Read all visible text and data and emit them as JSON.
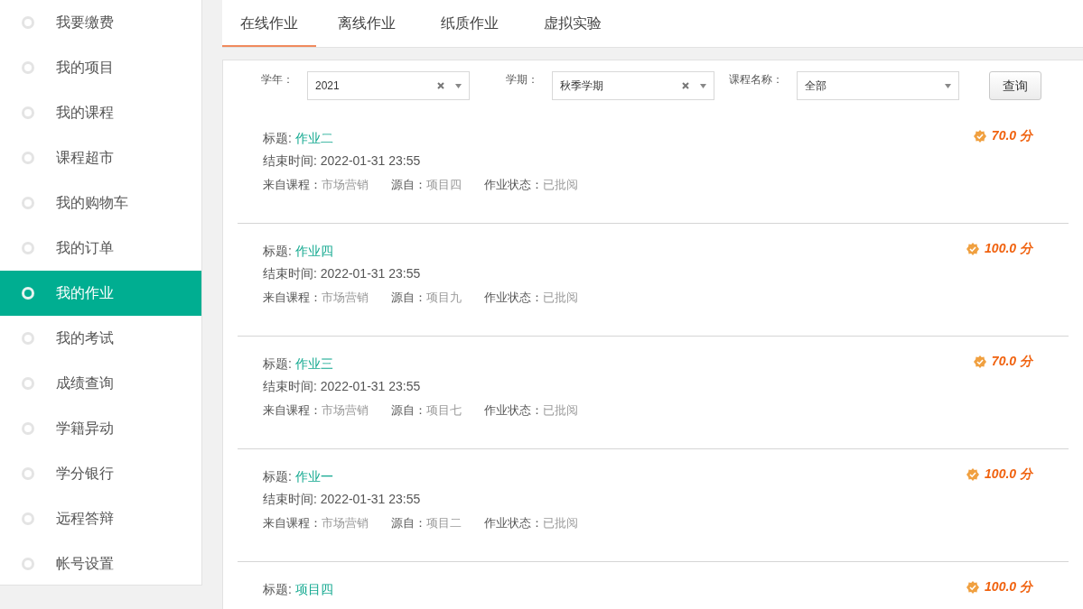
{
  "sidebar": {
    "items": [
      {
        "label": "我要缴费",
        "selected": false
      },
      {
        "label": "我的项目",
        "selected": false
      },
      {
        "label": "我的课程",
        "selected": false
      },
      {
        "label": "课程超市",
        "selected": false
      },
      {
        "label": "我的购物车",
        "selected": false
      },
      {
        "label": "我的订单",
        "selected": false
      },
      {
        "label": "我的作业",
        "selected": true
      },
      {
        "label": "我的考试",
        "selected": false
      },
      {
        "label": "成绩查询",
        "selected": false
      },
      {
        "label": "学籍异动",
        "selected": false
      },
      {
        "label": "学分银行",
        "selected": false
      },
      {
        "label": "远程答辩",
        "selected": false
      },
      {
        "label": "帐号设置",
        "selected": false
      }
    ]
  },
  "tabs": [
    {
      "label": "在线作业",
      "selected": true
    },
    {
      "label": "离线作业",
      "selected": false
    },
    {
      "label": "纸质作业",
      "selected": false
    },
    {
      "label": "虚拟实验",
      "selected": false
    }
  ],
  "filters": [
    {
      "label": "学年：",
      "value": "2021",
      "clearable": true
    },
    {
      "label": "学期：",
      "value": "秋季学期",
      "clearable": true
    },
    {
      "label": "课程名称：",
      "value": "全部",
      "clearable": false
    }
  ],
  "query_button": "查询",
  "assignments": [
    {
      "title_label": "标题:",
      "title": "作业二",
      "end_time": "结束时间: 2022-01-31 23:55",
      "course_label": "来自课程：",
      "course": "市场营销",
      "source_label": "源自：",
      "source": "项目四",
      "status_label": "作业状态：",
      "status": "已批阅",
      "score": "70.0 分"
    },
    {
      "title_label": "标题:",
      "title": "作业四",
      "end_time": "结束时间: 2022-01-31 23:55",
      "course_label": "来自课程：",
      "course": "市场营销",
      "source_label": "源自：",
      "source": "项目九",
      "status_label": "作业状态：",
      "status": "已批阅",
      "score": "100.0 分"
    },
    {
      "title_label": "标题:",
      "title": "作业三",
      "end_time": "结束时间: 2022-01-31 23:55",
      "course_label": "来自课程：",
      "course": "市场营销",
      "source_label": "源自：",
      "source": "项目七",
      "status_label": "作业状态：",
      "status": "已批阅",
      "score": "70.0 分"
    },
    {
      "title_label": "标题:",
      "title": "作业一",
      "end_time": "结束时间: 2022-01-31 23:55",
      "course_label": "来自课程：",
      "course": "市场营销",
      "source_label": "源自：",
      "source": "项目二",
      "status_label": "作业状态：",
      "status": "已批阅",
      "score": "100.0 分"
    },
    {
      "title_label": "标题:",
      "title": "项目四",
      "score": "100.0 分"
    }
  ]
}
